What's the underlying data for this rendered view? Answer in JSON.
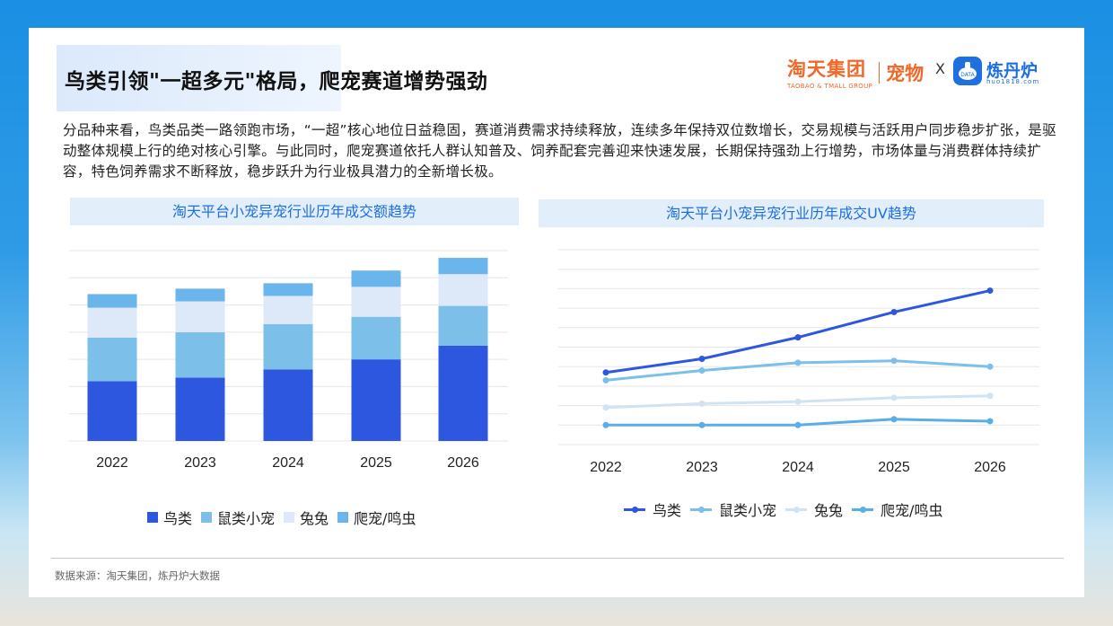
{
  "header": {
    "title": "鸟类引领\"一超多元\"格局，爬宠赛道增势强劲",
    "brand_main": "淘天集团",
    "brand_sub": "TAOBAO & TMALL GROUP",
    "brand_pet": "宠物",
    "times": "X",
    "partner_name": "炼丹炉",
    "partner_url": "huo1818.com"
  },
  "paragraph": "分品种来看，鸟类品类一路领跑市场，“一超”核心地位日益稳固，赛道消费需求持续释放，连续多年保持双位数增长，交易规模与活跃用户同步稳步扩张，是驱动整体规模上行的绝对核心引擎。与此同时，爬宠赛道依托人群认知普及、饲养配套完善迎来快速发展，长期保持强劲上行增势，市场体量与消费群体持续扩容，特色饲养需求不断释放，稳步跃升为行业极具潜力的全新增长极。",
  "colors": {
    "bird": "#2e57e0",
    "rodent": "#7cc0ea",
    "rabbit": "#dde8f9",
    "reptile": "#6ab6ec",
    "rabbit_line": "#cfe3f3",
    "reptile_line": "#5aaee6",
    "accent": "#1e6fe0"
  },
  "chart_data": [
    {
      "type": "bar",
      "stacked": true,
      "title": "淘天平台小宠异宠行业历年成交额趋势",
      "categories": [
        "2022",
        "2023",
        "2024",
        "2025",
        "2026"
      ],
      "series": [
        {
          "name": "鸟类",
          "values": [
            66,
            70,
            79,
            90,
            105
          ]
        },
        {
          "name": "鼠类小宠",
          "values": [
            48,
            50,
            50,
            47,
            44
          ]
        },
        {
          "name": "兔兔",
          "values": [
            33,
            34,
            31,
            33,
            35
          ]
        },
        {
          "name": "爬宠/鸣虫",
          "values": [
            15,
            14,
            14,
            18,
            18
          ]
        }
      ],
      "ylim": [
        0,
        210
      ],
      "grid": true,
      "legend": "bottom"
    },
    {
      "type": "line",
      "title": "淘天平台小宠异宠行业历年成交UV趋势",
      "categories": [
        "2022",
        "2023",
        "2024",
        "2025",
        "2026"
      ],
      "series": [
        {
          "name": "鸟类",
          "values": [
            37,
            44,
            55,
            68,
            79
          ]
        },
        {
          "name": "鼠类小宠",
          "values": [
            33,
            38,
            42,
            43,
            40
          ]
        },
        {
          "name": "兔兔",
          "values": [
            19,
            21,
            22,
            24,
            25
          ]
        },
        {
          "name": "爬宠/鸣虫",
          "values": [
            10,
            10,
            10,
            13,
            12
          ]
        }
      ],
      "ylim": [
        0,
        100
      ],
      "grid": true,
      "legend": "bottom"
    }
  ],
  "footer": {
    "source": "数据来源：淘天集团，炼丹炉大数据"
  }
}
